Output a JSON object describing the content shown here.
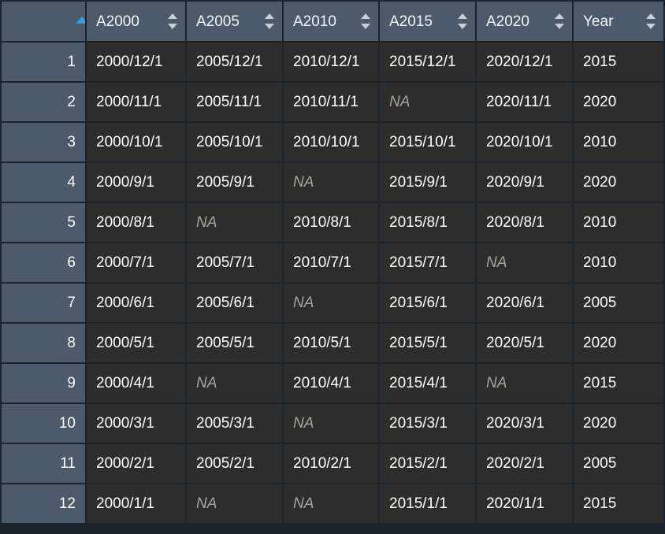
{
  "table": {
    "sort": {
      "column": "rownum",
      "direction": "asc",
      "active_color": "#3b9ae1",
      "inactive_color": "#c9ced4"
    },
    "colors": {
      "header_bg": "#4c5a69",
      "rownum_bg": "#4c5a69",
      "cell_bg": "#2d2d2d",
      "grid_line": "#1b232d",
      "text": "#ffffff",
      "na_text": "#a8a49c",
      "accent": "#3b9ae1"
    },
    "columns": [
      {
        "key": "rownum",
        "label": "",
        "sortable": true,
        "sorted": "asc"
      },
      {
        "key": "A2000",
        "label": "A2000",
        "sortable": true,
        "sorted": "none"
      },
      {
        "key": "A2005",
        "label": "A2005",
        "sortable": true,
        "sorted": "none"
      },
      {
        "key": "A2010",
        "label": "A2010",
        "sortable": true,
        "sorted": "none"
      },
      {
        "key": "A2015",
        "label": "A2015",
        "sortable": true,
        "sorted": "none"
      },
      {
        "key": "A2020",
        "label": "A2020",
        "sortable": true,
        "sorted": "none"
      },
      {
        "key": "Year",
        "label": "Year",
        "sortable": true,
        "sorted": "none"
      }
    ],
    "na_label": "NA",
    "rows": [
      {
        "rownum": "1",
        "A2000": "2000/12/1",
        "A2005": "2005/12/1",
        "A2010": "2010/12/1",
        "A2015": "2015/12/1",
        "A2020": "2020/12/1",
        "Year": "2015"
      },
      {
        "rownum": "2",
        "A2000": "2000/11/1",
        "A2005": "2005/11/1",
        "A2010": "2010/11/1",
        "A2015": "NA",
        "A2020": "2020/11/1",
        "Year": "2020"
      },
      {
        "rownum": "3",
        "A2000": "2000/10/1",
        "A2005": "2005/10/1",
        "A2010": "2010/10/1",
        "A2015": "2015/10/1",
        "A2020": "2020/10/1",
        "Year": "2010"
      },
      {
        "rownum": "4",
        "A2000": "2000/9/1",
        "A2005": "2005/9/1",
        "A2010": "NA",
        "A2015": "2015/9/1",
        "A2020": "2020/9/1",
        "Year": "2020"
      },
      {
        "rownum": "5",
        "A2000": "2000/8/1",
        "A2005": "NA",
        "A2010": "2010/8/1",
        "A2015": "2015/8/1",
        "A2020": "2020/8/1",
        "Year": "2010"
      },
      {
        "rownum": "6",
        "A2000": "2000/7/1",
        "A2005": "2005/7/1",
        "A2010": "2010/7/1",
        "A2015": "2015/7/1",
        "A2020": "NA",
        "Year": "2010"
      },
      {
        "rownum": "7",
        "A2000": "2000/6/1",
        "A2005": "2005/6/1",
        "A2010": "NA",
        "A2015": "2015/6/1",
        "A2020": "2020/6/1",
        "Year": "2005"
      },
      {
        "rownum": "8",
        "A2000": "2000/5/1",
        "A2005": "2005/5/1",
        "A2010": "2010/5/1",
        "A2015": "2015/5/1",
        "A2020": "2020/5/1",
        "Year": "2020"
      },
      {
        "rownum": "9",
        "A2000": "2000/4/1",
        "A2005": "NA",
        "A2010": "2010/4/1",
        "A2015": "2015/4/1",
        "A2020": "NA",
        "Year": "2015"
      },
      {
        "rownum": "10",
        "A2000": "2000/3/1",
        "A2005": "2005/3/1",
        "A2010": "NA",
        "A2015": "2015/3/1",
        "A2020": "2020/3/1",
        "Year": "2020"
      },
      {
        "rownum": "11",
        "A2000": "2000/2/1",
        "A2005": "2005/2/1",
        "A2010": "2010/2/1",
        "A2015": "2015/2/1",
        "A2020": "2020/2/1",
        "Year": "2005"
      },
      {
        "rownum": "12",
        "A2000": "2000/1/1",
        "A2005": "NA",
        "A2010": "NA",
        "A2015": "2015/1/1",
        "A2020": "2020/1/1",
        "Year": "2015"
      }
    ]
  }
}
